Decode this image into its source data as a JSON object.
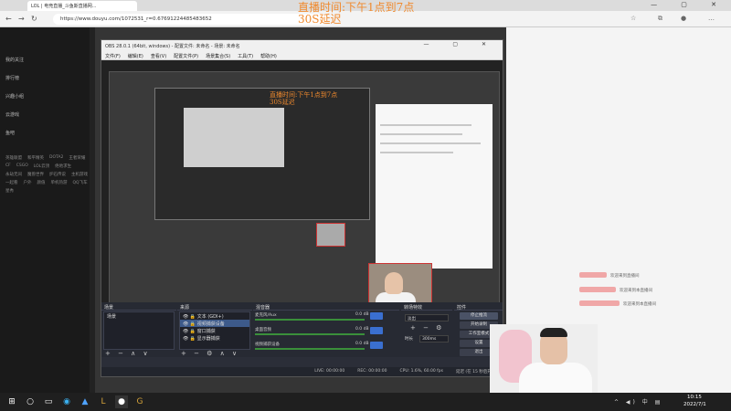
{
  "browser": {
    "tab_title": "LOL | 电竞直播_斗鱼斯直播网...",
    "url": "https://www.douyu.com/1072531_r=0.67691224485483652",
    "window_controls": "— ▢ ✕"
  },
  "stream_notice": {
    "line1": "直播时间:下午1点到7点",
    "line2": "30S延迟"
  },
  "inner_notice": {
    "line1": "直播时间:下午1点到7点",
    "line2": "30S延迟"
  },
  "leftnav": {
    "items": [
      "我的关注",
      "排行榜",
      "兴趣小组",
      "云游戏",
      "鱼吧"
    ],
    "grid": [
      "英雄联盟",
      "和平精英",
      "DOTA2",
      "王者荣耀",
      "CF",
      "CSGO",
      "LOL云顶",
      "绝地求生",
      "永劫无间",
      "魔兽世界",
      "炉石传说",
      "主机游戏",
      "一起看",
      "户外",
      "颜值",
      "单机热游",
      "QQ飞车",
      "星秀"
    ]
  },
  "right_panel": {
    "rows": [
      "欢迎来到直播间",
      "欢迎来到本直播间",
      "欢迎来到本直播间"
    ]
  },
  "obs": {
    "title": "OBS 28.0.1 (64bit, windows) - 配置文件: 未命名 - 场景: 未命名",
    "window_controls": "— ▢ ✕",
    "menu": [
      "文件(F)",
      "编辑(E)",
      "查看(V)",
      "配置文件(P)",
      "场景集合(S)",
      "工具(T)",
      "帮助(H)"
    ],
    "docks": {
      "scenes": {
        "title": "场景",
        "items": [
          "场景"
        ]
      },
      "sources": {
        "title": "来源",
        "items": [
          "文本 (GDI+)",
          "视频捕获设备",
          "窗口捕获",
          "显示器捕获"
        ],
        "selected": 1
      },
      "mixer": {
        "title": "混音器",
        "channels": [
          {
            "name": "麦克风/Aux",
            "level": "0.0 dB"
          },
          {
            "name": "桌面音频",
            "level": "0.0 dB"
          },
          {
            "name": "视频捕获设备",
            "level": "0.0 dB"
          }
        ]
      },
      "transitions": {
        "title": "转场特效",
        "type": "淡出",
        "duration_label": "时长",
        "duration": "300ms"
      },
      "controls": {
        "title": "控件",
        "buttons": [
          "停止推流",
          "开始录制",
          "工作室模式",
          "设置",
          "退出"
        ]
      }
    },
    "status": {
      "live": "LIVE: 00:00:00",
      "rec": "REC: 00:00:00",
      "cpu": "CPU: 1.6%, 60.00 fps",
      "delay": "延迟 (在 15 秒后开始)"
    }
  },
  "taskbar": {
    "time": "10:15",
    "date": "2022/7/1",
    "tray": "^ ◀) 中 ▤"
  },
  "colors": {
    "notice": "#f08a2e",
    "obs_bg": "#2b2e38",
    "selection": "#3d5a8a"
  }
}
